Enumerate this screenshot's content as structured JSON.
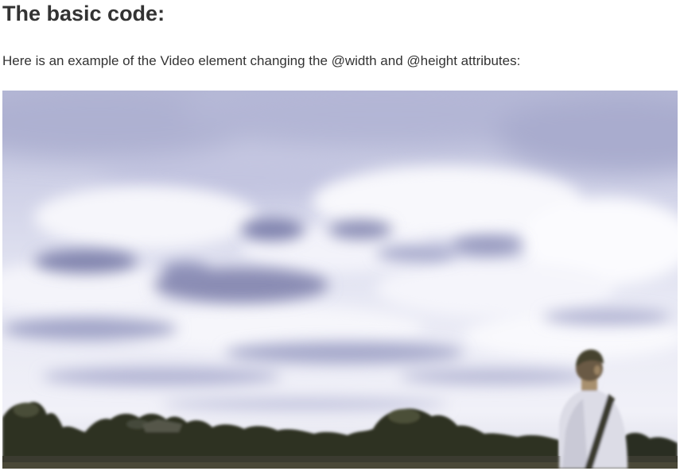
{
  "section": {
    "heading": "The basic code:",
    "description": "Here is an example of the Video element changing the @width and @height attributes:"
  },
  "video": {
    "scene": "cloudy-sky-with-treeline-and-person",
    "colors": {
      "sky_top": "#b9bcd8",
      "sky_mid": "#e2e3f1",
      "cloud_shadow": "#8d90b8",
      "cloud_light": "#f7f7fc",
      "tree_dark": "#2f3224",
      "ground": "#3c3c30",
      "shirt": "#dcdce4",
      "hair": "#4a4a3e"
    }
  }
}
